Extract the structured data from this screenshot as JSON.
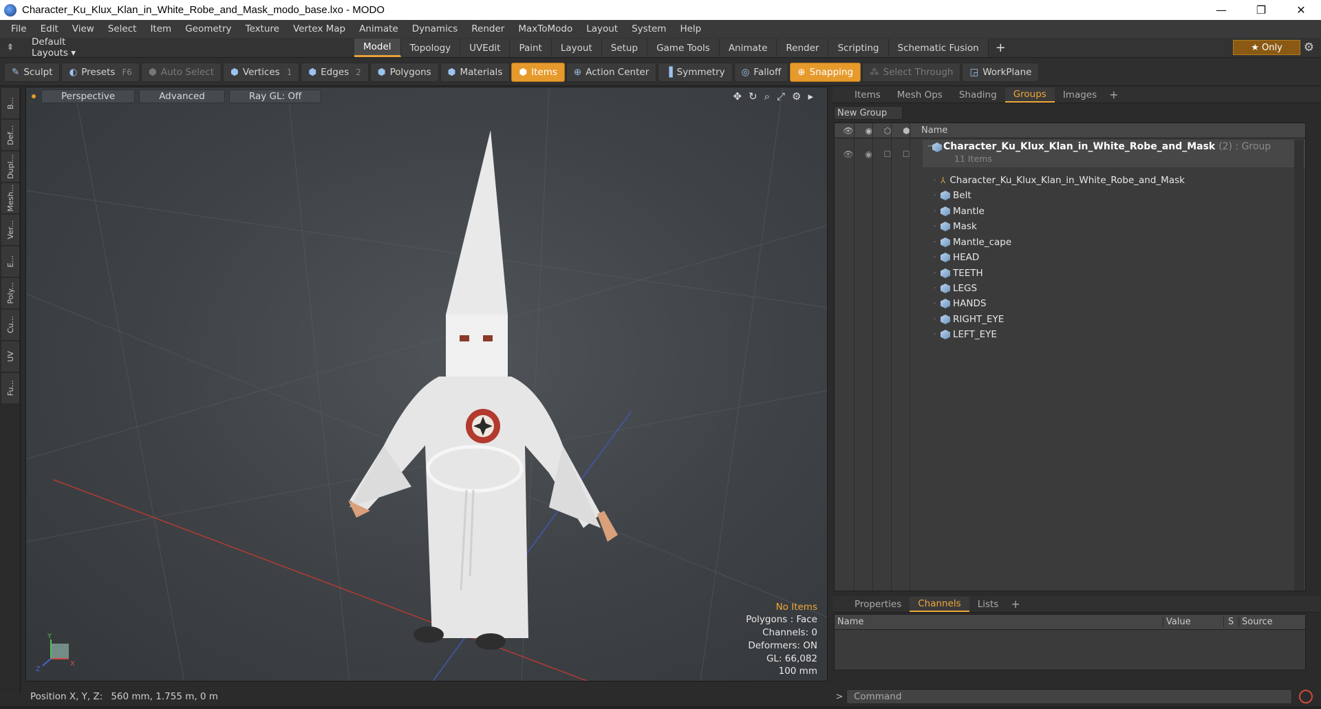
{
  "window": {
    "title": "Character_Ku_Klux_Klan_in_White_Robe_and_Mask_modo_base.lxo - MODO",
    "minimize": "—",
    "maximize": "❐",
    "close": "✕"
  },
  "menu": [
    "File",
    "Edit",
    "View",
    "Select",
    "Item",
    "Geometry",
    "Texture",
    "Vertex Map",
    "Animate",
    "Dynamics",
    "Render",
    "MaxToModo",
    "Layout",
    "System",
    "Help"
  ],
  "layoutbar": {
    "default_layouts": "Default Layouts ▾",
    "tabs": [
      "Model",
      "Topology",
      "UVEdit",
      "Paint",
      "Layout",
      "Setup",
      "Game Tools",
      "Animate",
      "Render",
      "Scripting",
      "Schematic Fusion"
    ],
    "active_tab": "Model",
    "plus": "+",
    "only_label": "★  Only"
  },
  "toolbar": {
    "sculpt": "Sculpt",
    "presets": "Presets",
    "presets_key": "F6",
    "auto_select": "Auto Select",
    "vertices": "Vertices",
    "vertices_count": "1",
    "edges": "Edges",
    "edges_count": "2",
    "polygons": "Polygons",
    "materials": "Materials",
    "items": "Items",
    "action_center": "Action Center",
    "symmetry": "Symmetry",
    "falloff": "Falloff",
    "snapping": "Snapping",
    "select_through": "Select Through",
    "workplane": "WorkPlane"
  },
  "left_tools": [
    "B...",
    "Def...",
    "Dupl...",
    "Mesh...",
    "Ver...",
    "E...",
    "Poly...",
    "Cu...",
    "UV",
    "Fu..."
  ],
  "viewport": {
    "perspective": "Perspective",
    "advanced": "Advanced",
    "raygl": "Ray GL: Off",
    "info": {
      "no_items": "No Items",
      "polygons": "Polygons : Face",
      "channels": "Channels: 0",
      "deformers": "Deformers: ON",
      "gl": "GL: 66,082",
      "scale": "100 mm"
    },
    "axis_y": "Y",
    "axis_x": "X",
    "axis_z": "Z"
  },
  "status": {
    "label": "Position X, Y, Z:",
    "value": "560 mm, 1.755 m, 0 m"
  },
  "right_tabs": [
    "Items",
    "Mesh Ops",
    "Shading",
    "Groups",
    "Images"
  ],
  "right_active": "Groups",
  "new_group": "New Group",
  "tree": {
    "name_header": "Name",
    "group_name": "Character_Ku_Klux_Klan_in_White_Robe_and_Mask",
    "group_tag": "(2) : Group",
    "group_sub": "11 Items",
    "items": [
      {
        "name": "Character_Ku_Klux_Klan_in_White_Robe_and_Mask",
        "kind": "locator"
      },
      {
        "name": "Belt",
        "kind": "mesh"
      },
      {
        "name": "Mantle",
        "kind": "mesh"
      },
      {
        "name": "Mask",
        "kind": "mesh"
      },
      {
        "name": "Mantle_cape",
        "kind": "mesh"
      },
      {
        "name": "HEAD",
        "kind": "mesh"
      },
      {
        "name": "TEETH",
        "kind": "mesh"
      },
      {
        "name": "LEGS",
        "kind": "mesh"
      },
      {
        "name": "HANDS",
        "kind": "mesh"
      },
      {
        "name": "RIGHT_EYE",
        "kind": "mesh"
      },
      {
        "name": "LEFT_EYE",
        "kind": "mesh"
      }
    ]
  },
  "prop_tabs": [
    "Properties",
    "Channels",
    "Lists"
  ],
  "prop_active": "Channels",
  "prop_headers": {
    "name": "Name",
    "value": "Value",
    "s": "S",
    "source": "Source"
  },
  "command_placeholder": "Command"
}
